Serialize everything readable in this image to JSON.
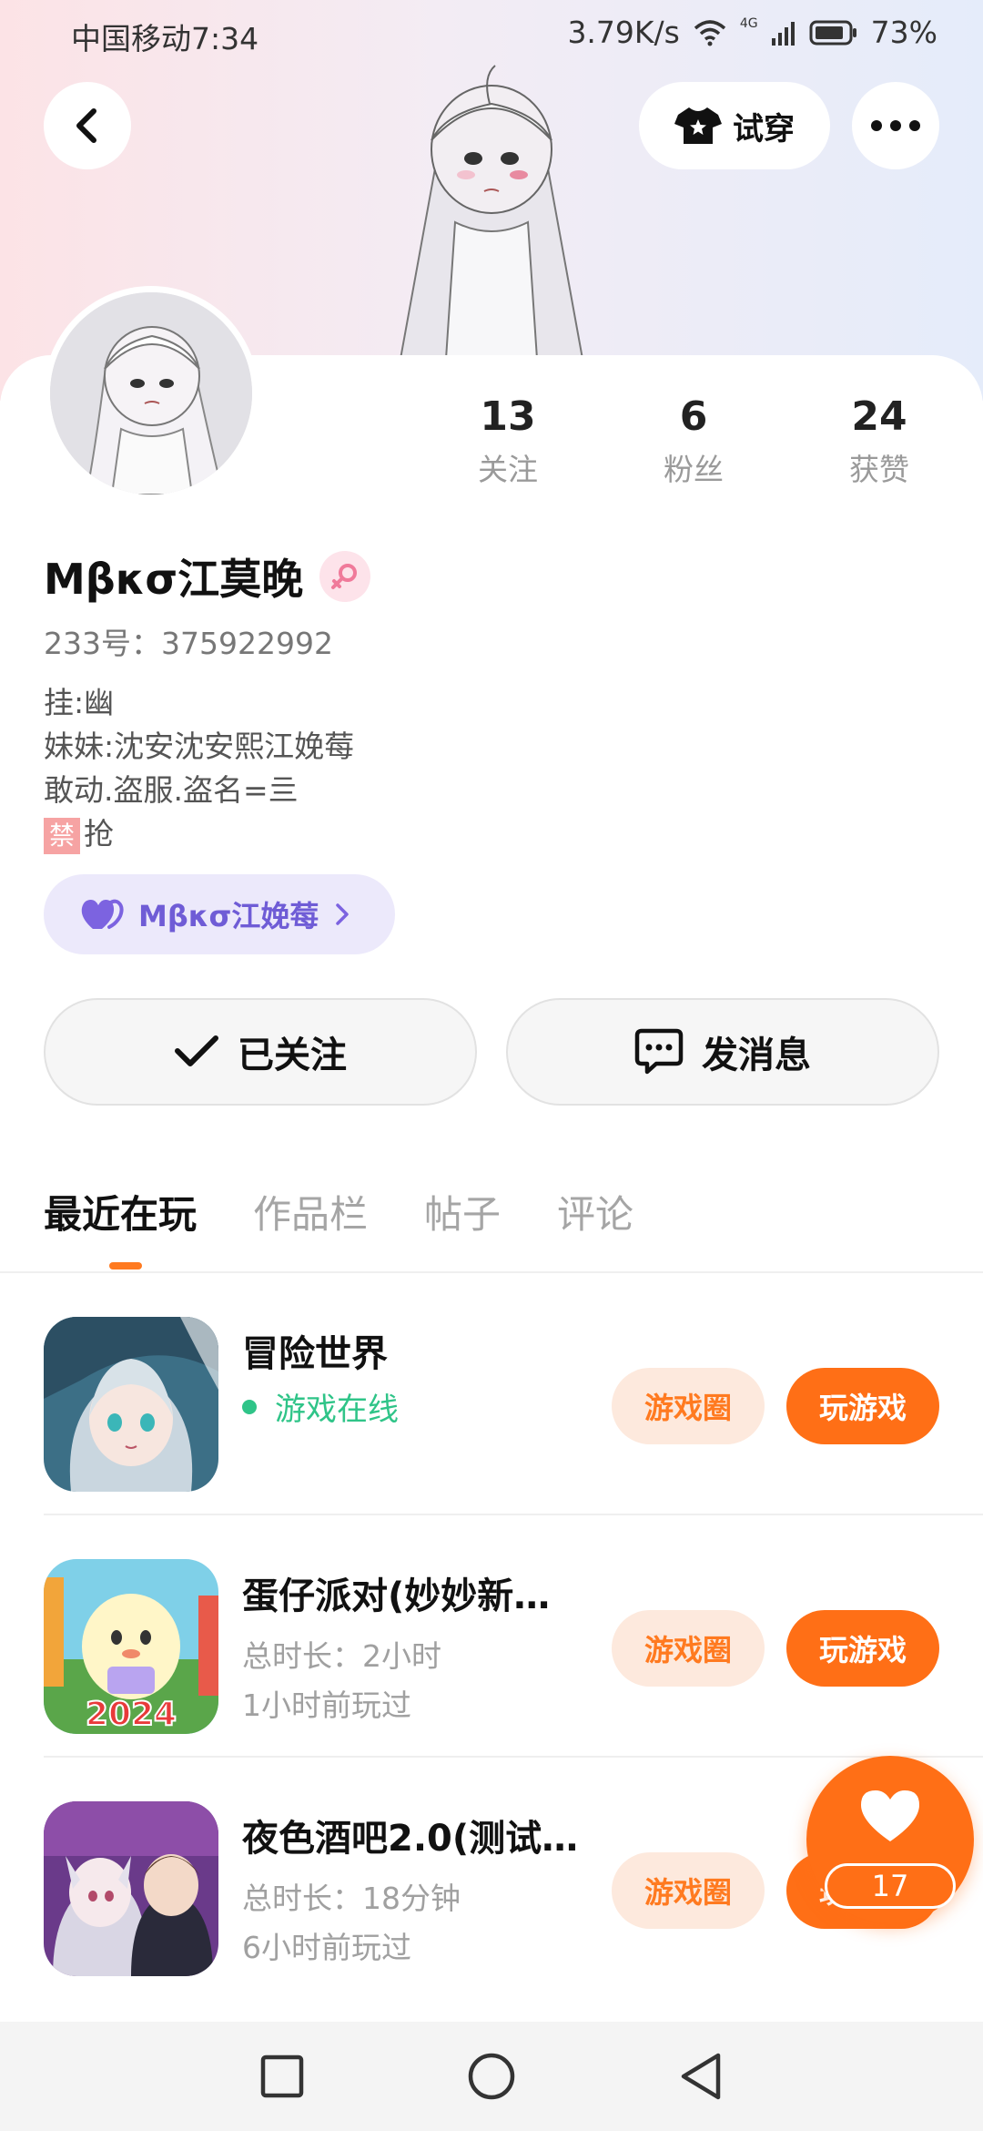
{
  "status_bar": {
    "carrier_time": "中国移动7:34",
    "network_speed": "3.79K/s",
    "network_type": "4G",
    "battery": "73%"
  },
  "header": {
    "back_icon": "chevron-left-icon",
    "try_on_label": "试穿",
    "try_on_icon": "tshirt-icon",
    "more_icon": "more-dots-icon"
  },
  "profile": {
    "stats": [
      {
        "value": "13",
        "label": "关注"
      },
      {
        "value": "6",
        "label": "粉丝"
      },
      {
        "value": "24",
        "label": "获赞"
      }
    ],
    "username": "Mβκσ江莫晚",
    "gender_icon": "female-icon",
    "uid": "233号：375922992",
    "bio": {
      "line1": "挂:幽",
      "line2": "妹妹:沈安沈安熙江娩莓",
      "line3": "敢动.盗服.盗名=亖",
      "ban_tag": "禁",
      "line4": "抢"
    },
    "linked_user": "Mβκσ江娩莓",
    "link_icon": "heart-pair-icon"
  },
  "actions": {
    "follow_label": "已关注",
    "message_label": "发消息"
  },
  "tabs": [
    "最近在玩",
    "作品栏",
    "帖子",
    "评论"
  ],
  "active_tab": 0,
  "games": [
    {
      "title": "冒险世界",
      "status": "游戏在线",
      "circle_label": "游戏圈",
      "play_label": "玩游戏"
    },
    {
      "title": "蛋仔派对(妙妙新…",
      "duration": "总时长：2小时",
      "last_played": "1小时前玩过",
      "circle_label": "游戏圈",
      "play_label": "玩游戏",
      "icon_badge": "2024"
    },
    {
      "title": "夜色酒吧2.0(测试…",
      "duration": "总时长：18分钟",
      "last_played": "6小时前玩过",
      "circle_label": "游戏圈",
      "play_label": "玩游戏"
    }
  ],
  "like_fab": {
    "count": "17",
    "icon": "heart-icon"
  },
  "colors": {
    "accent": "#ff6f16",
    "accent_light": "#fde9dd",
    "online": "#2fc488",
    "link_chip": "#ece9fb",
    "link_text": "#6f5cd6"
  }
}
